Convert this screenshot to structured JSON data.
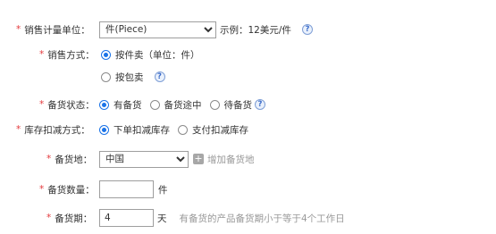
{
  "sales_unit": {
    "label": "销售计量单位：",
    "selected": "件(Piece)",
    "example": "示例：12美元/件"
  },
  "sales_method": {
    "label": "销售方式：",
    "options": [
      "按件卖（单位：件）",
      "按包卖"
    ],
    "selected_index": 0
  },
  "stock_status": {
    "label": "备货状态：",
    "options": [
      "有备货",
      "备货途中",
      "待备货"
    ],
    "selected_index": 0
  },
  "inventory_deduction": {
    "label": "库存扣减方式：",
    "options": [
      "下单扣减库存",
      "支付扣减库存"
    ],
    "selected_index": 0
  },
  "stock_location": {
    "label": "备货地：",
    "selected": "中国",
    "add_label": "增加备货地"
  },
  "stock_quantity": {
    "label": "备货数量：",
    "value": "",
    "unit": "件"
  },
  "stock_period": {
    "label": "备货期：",
    "value": "4",
    "unit": "天",
    "hint": "有备货的产品备货期小于等于4个工作日"
  },
  "icons": {
    "required_marker": "*",
    "help": "?",
    "add": "+"
  },
  "colors": {
    "required": "#e4393c",
    "radio_selected": "#1a73e8",
    "hint_text": "#999999"
  }
}
